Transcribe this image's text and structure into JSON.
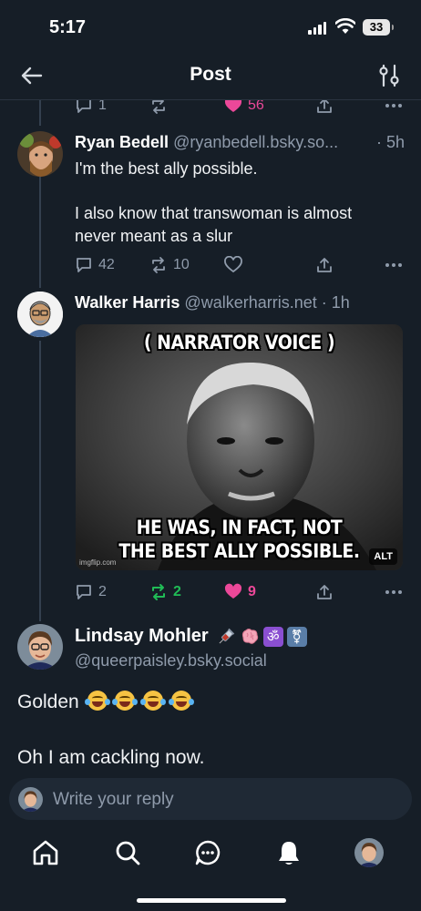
{
  "status_bar": {
    "time": "5:17",
    "battery": "33"
  },
  "header": {
    "title": "Post"
  },
  "previous_post_actions": {
    "reply_count": "1",
    "like_count": "56"
  },
  "posts": [
    {
      "author_name": "Ryan Bedell",
      "author_handle": "@ryanbedell.bsky.so...",
      "time": "· 5h",
      "text_line1": "I'm the best ally possible.",
      "text_line2": "I also know that transwoman is almost",
      "text_line3": "never meant as a slur",
      "replies": "42",
      "reposts": "10"
    },
    {
      "author_name": "Walker Harris",
      "author_handle": "@walkerharris.net",
      "time": "· 1h",
      "image": {
        "top_caption": "( NARRATOR VOICE )",
        "bottom_caption_line1": "HE WAS, IN FACT, NOT",
        "bottom_caption_line2": "THE BEST ALLY POSSIBLE.",
        "watermark": "imgflip.com",
        "alt_badge": "ALT"
      },
      "replies": "2",
      "reposts": "2",
      "likes": "9"
    }
  ],
  "focused_post": {
    "author_name": "Lindsay Mohler",
    "author_handle": "@queerpaisley.bsky.social",
    "badges": [
      "syringe-emoji",
      "brain-emoji",
      "om-emoji",
      "transgender-symbol-emoji"
    ],
    "badge_om": "ॐ",
    "badge_trans": "⚧",
    "text_line1": "Golden",
    "text_line2": "Oh I am cackling now."
  },
  "reply_bar": {
    "placeholder": "Write your reply"
  },
  "tabs": [
    "home-icon",
    "search-icon",
    "chat-icon",
    "notifications-icon",
    "profile-avatar"
  ],
  "colors": {
    "background": "#161e27",
    "like_active": "#ec4899",
    "repost_active": "#20bc56",
    "muted": "#8f9bab"
  }
}
